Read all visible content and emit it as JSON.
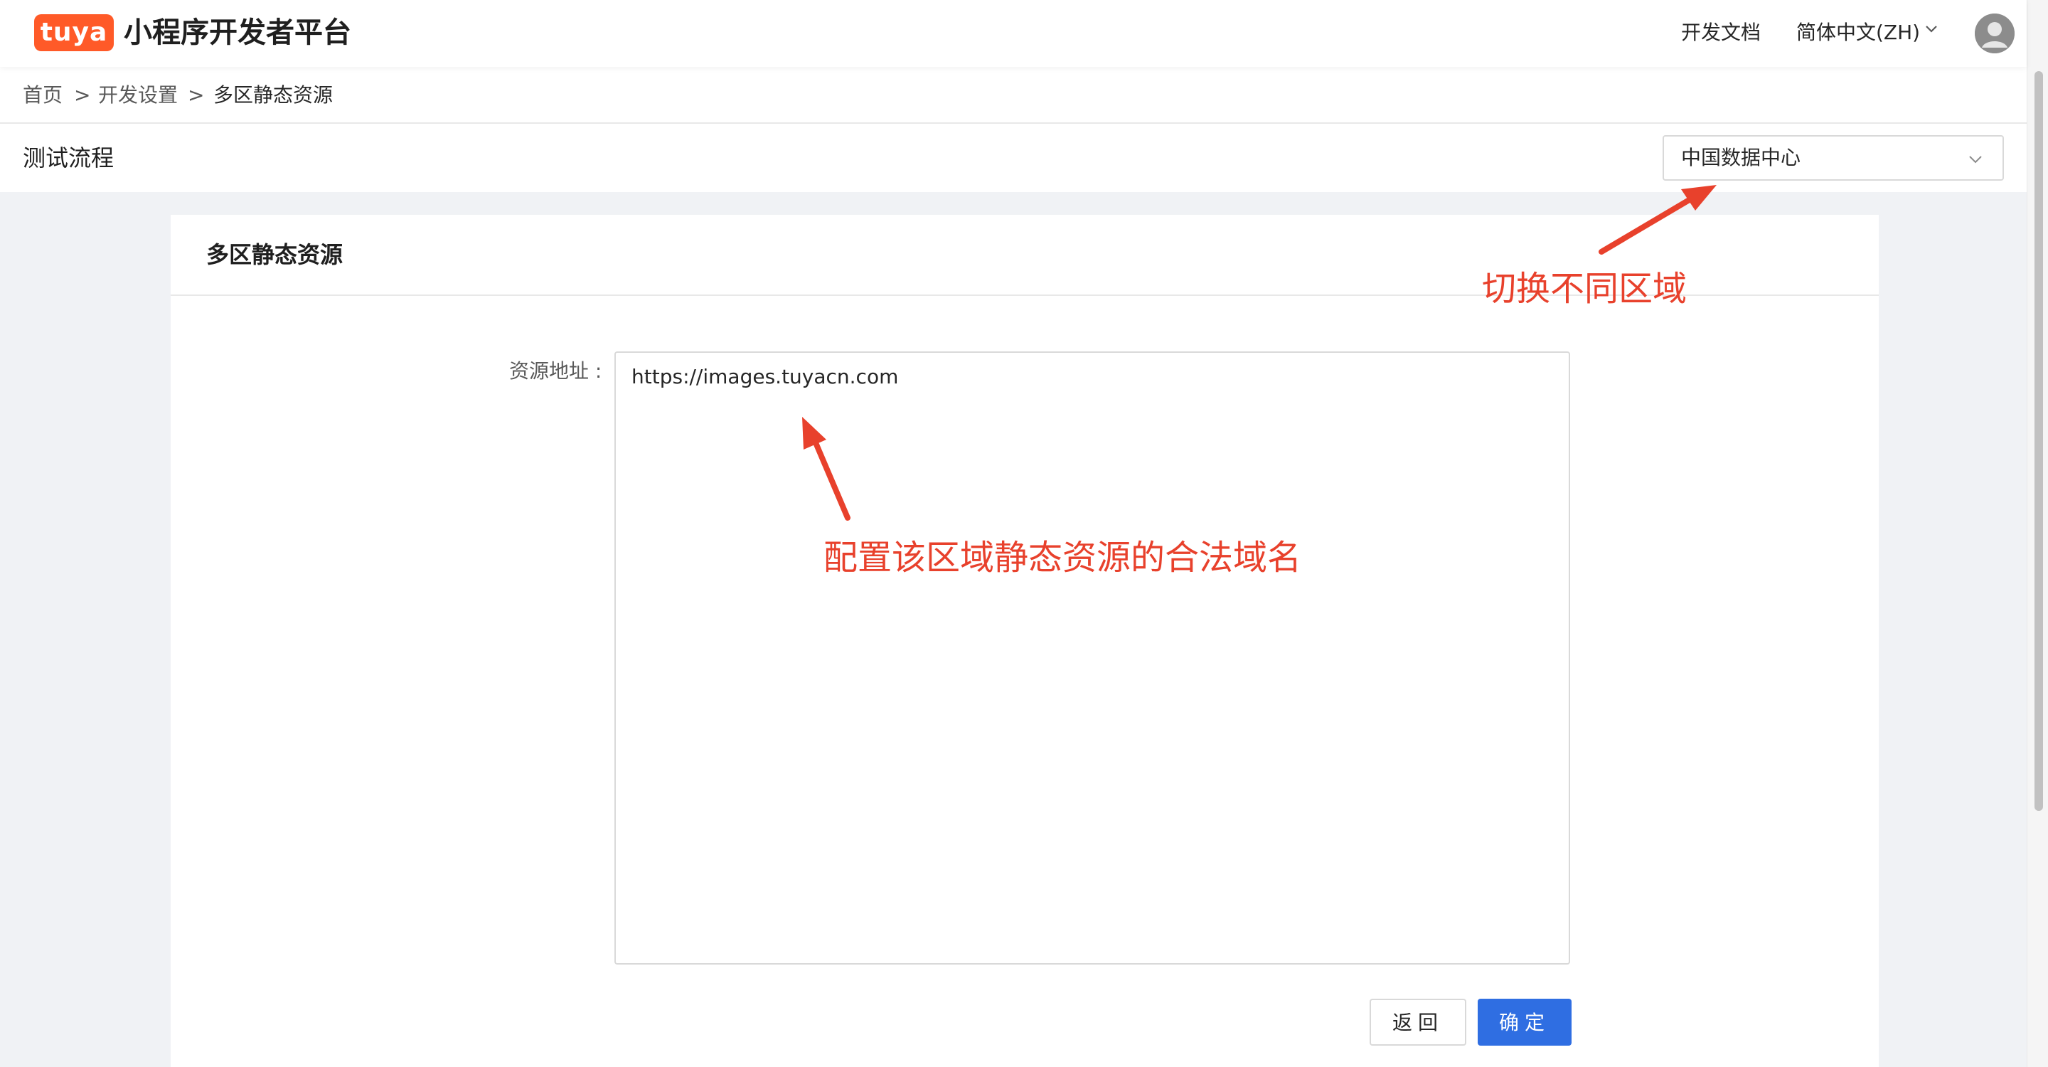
{
  "header": {
    "logo_text": "tuya",
    "app_title": "小程序开发者平台",
    "docs_link": "开发文档",
    "language": "简体中文(ZH)"
  },
  "breadcrumb": {
    "items": [
      "首页",
      "开发设置",
      "多区静态资源"
    ],
    "separator": ">"
  },
  "subheader": {
    "title": "测试流程",
    "region_selected": "中国数据中心"
  },
  "card": {
    "title": "多区静态资源",
    "field_label": "资源地址 :",
    "field_value": "https://images.tuyacn.com",
    "back_button": "返回",
    "ok_button": "确定"
  },
  "annotations": {
    "region_note": "切换不同区域",
    "field_note": "配置该区域静态资源的合法域名",
    "color": "#e8412c"
  },
  "colors": {
    "brand": "#ff5a28",
    "primary": "#2f6ee2",
    "page_bg": "#f0f2f5"
  },
  "icons": [
    "chevron-down-icon",
    "avatar-icon",
    "arrow-annotation-icon"
  ]
}
